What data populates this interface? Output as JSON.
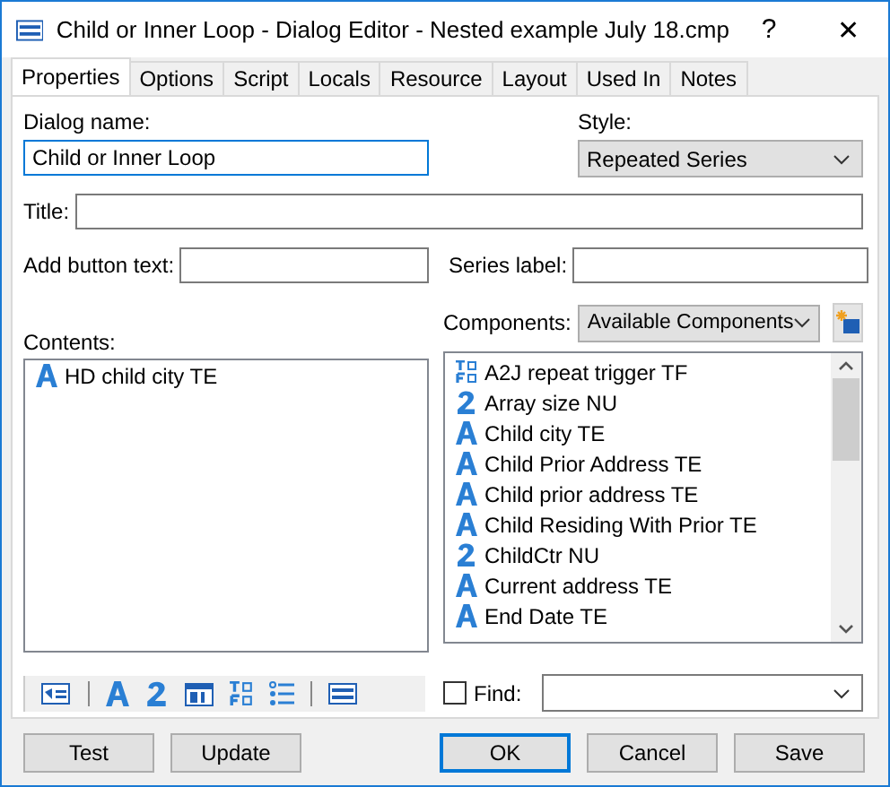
{
  "window": {
    "title": "Child or Inner Loop - Dialog Editor - Nested example July 18.cmp",
    "help": "?",
    "close": "✕"
  },
  "tabs": [
    {
      "label": "Properties",
      "selected": true
    },
    {
      "label": "Options",
      "selected": false
    },
    {
      "label": "Script",
      "selected": false
    },
    {
      "label": "Locals",
      "selected": false
    },
    {
      "label": "Resource",
      "selected": false
    },
    {
      "label": "Layout",
      "selected": false
    },
    {
      "label": "Used In",
      "selected": false
    },
    {
      "label": "Notes",
      "selected": false
    }
  ],
  "dialog_name": {
    "label": "Dialog name:",
    "value": "Child or Inner Loop"
  },
  "style": {
    "label": "Style:",
    "value": "Repeated Series"
  },
  "title_field": {
    "label": "Title:"
  },
  "add_button_text": {
    "label": "Add button text:"
  },
  "series_label": {
    "label": "Series label:"
  },
  "contents": {
    "label": "Contents:",
    "items": [
      {
        "kind": "text",
        "label": "HD child city TE"
      }
    ]
  },
  "components": {
    "label": "Components:",
    "filter": "Available Components",
    "items": [
      {
        "kind": "truefalse",
        "label": "A2J repeat trigger TF"
      },
      {
        "kind": "number",
        "label": "Array size NU"
      },
      {
        "kind": "text",
        "label": "Child city TE"
      },
      {
        "kind": "text",
        "label": "Child Prior Address TE"
      },
      {
        "kind": "text",
        "label": "Child prior address TE"
      },
      {
        "kind": "text",
        "label": "Child Residing With Prior TE"
      },
      {
        "kind": "number",
        "label": "ChildCtr NU"
      },
      {
        "kind": "text",
        "label": "Current address TE"
      },
      {
        "kind": "text",
        "label": "End Date TE"
      }
    ]
  },
  "find": {
    "label": "Find:",
    "checked": false
  },
  "buttons_left": [
    "Test",
    "Update"
  ],
  "buttons_right": [
    {
      "label": "OK",
      "default": true
    },
    {
      "label": "Cancel",
      "default": false
    },
    {
      "label": "Save",
      "default": false
    }
  ]
}
